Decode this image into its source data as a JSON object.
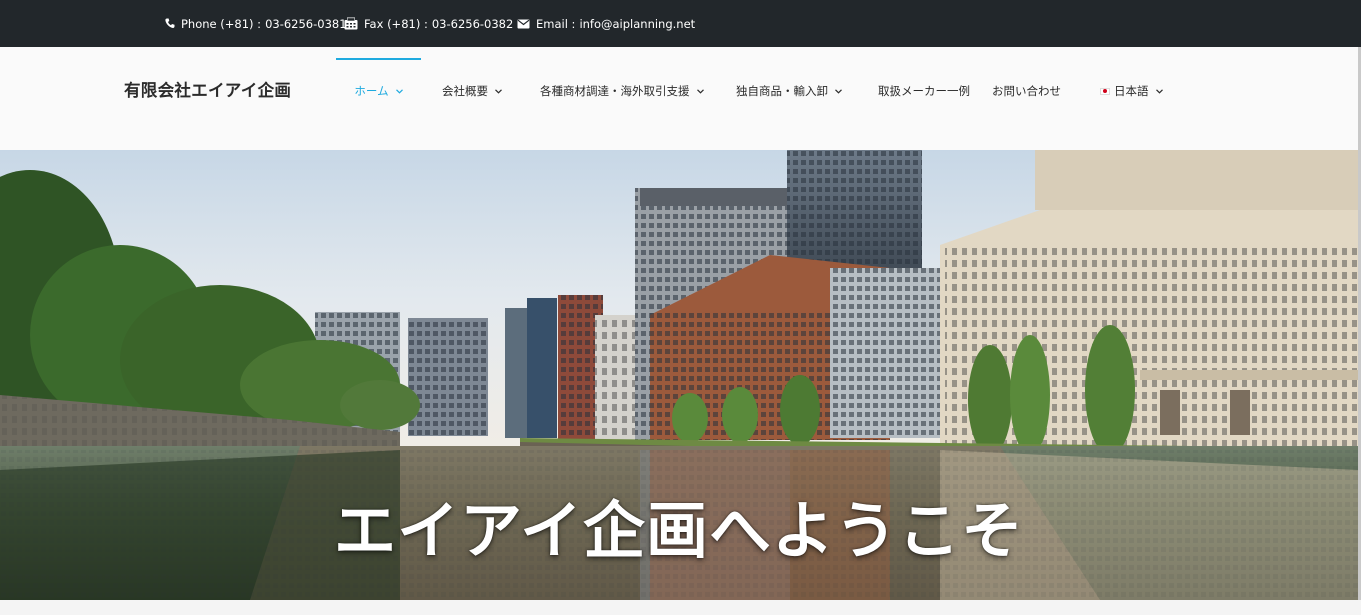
{
  "topbar": {
    "phone": {
      "icon": "phone-icon",
      "label": "Phone (+81) :",
      "value": "03-6256-0381"
    },
    "fax": {
      "icon": "fax-icon",
      "label": "Fax (+81) :",
      "value": "03-6256-0382"
    },
    "email": {
      "icon": "envelope-icon",
      "label": "Email :",
      "value": "info@aiplanning.net"
    }
  },
  "header": {
    "logo": "有限会社エイアイ企画",
    "nav": [
      {
        "label": "ホーム",
        "dropdown": true,
        "active": true
      },
      {
        "label": "会社概要",
        "dropdown": true
      },
      {
        "label": "各種商材調達・海外取引支援",
        "dropdown": true
      },
      {
        "label": "独自商品・輸入卸",
        "dropdown": true
      },
      {
        "label": "取扱メーカー一例",
        "dropdown": false
      },
      {
        "label": "お問い合わせ",
        "dropdown": false
      },
      {
        "label": "日本語",
        "dropdown": true,
        "flag": "japan-flag-icon"
      }
    ]
  },
  "hero": {
    "title": "エイアイ企画へようこそ",
    "image": "tokyo-marunouchi-skyline-moat-photo"
  },
  "colors": {
    "topbar_bg": "#22272b",
    "header_bg": "#fafafa",
    "accent": "#1eaadf",
    "text": "#2b2b2b"
  }
}
